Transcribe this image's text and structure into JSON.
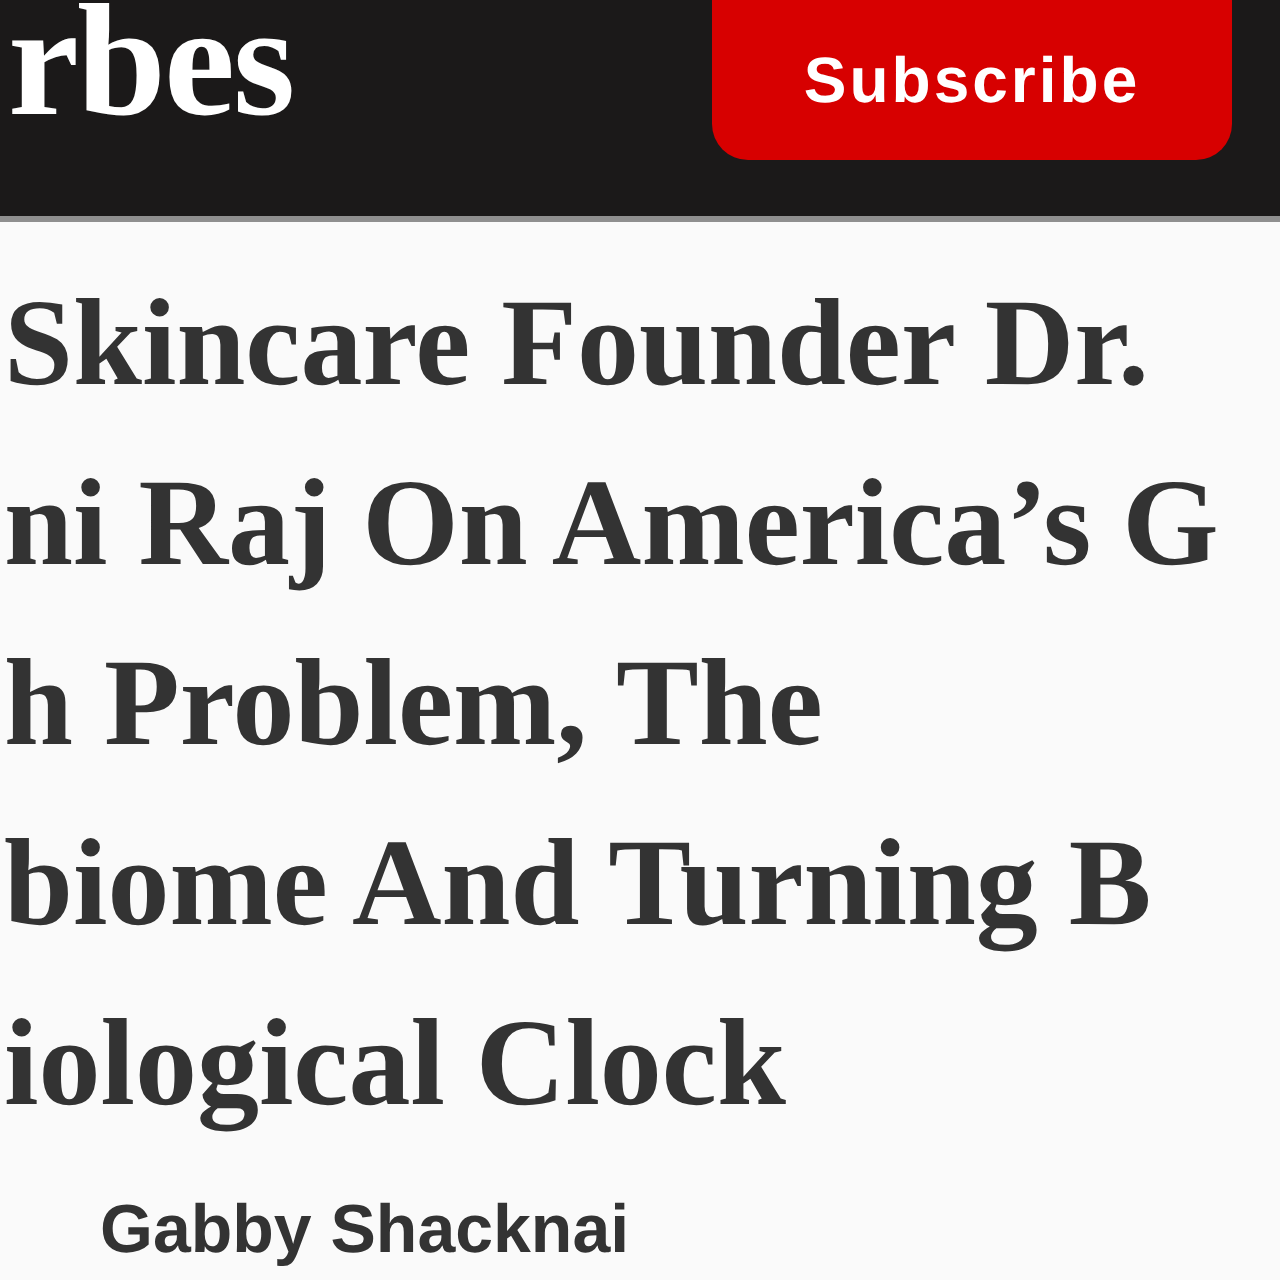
{
  "header": {
    "logo": "rbes",
    "subscribe_button": "Subscribe"
  },
  "headline": {
    "lines": [
      "Skincare Founder Dr.",
      "ni Raj On America’s G",
      "h Problem, The",
      "biome And Turning B",
      "iological Clock"
    ]
  },
  "byline": {
    "author": "Gabby Shacknai"
  }
}
